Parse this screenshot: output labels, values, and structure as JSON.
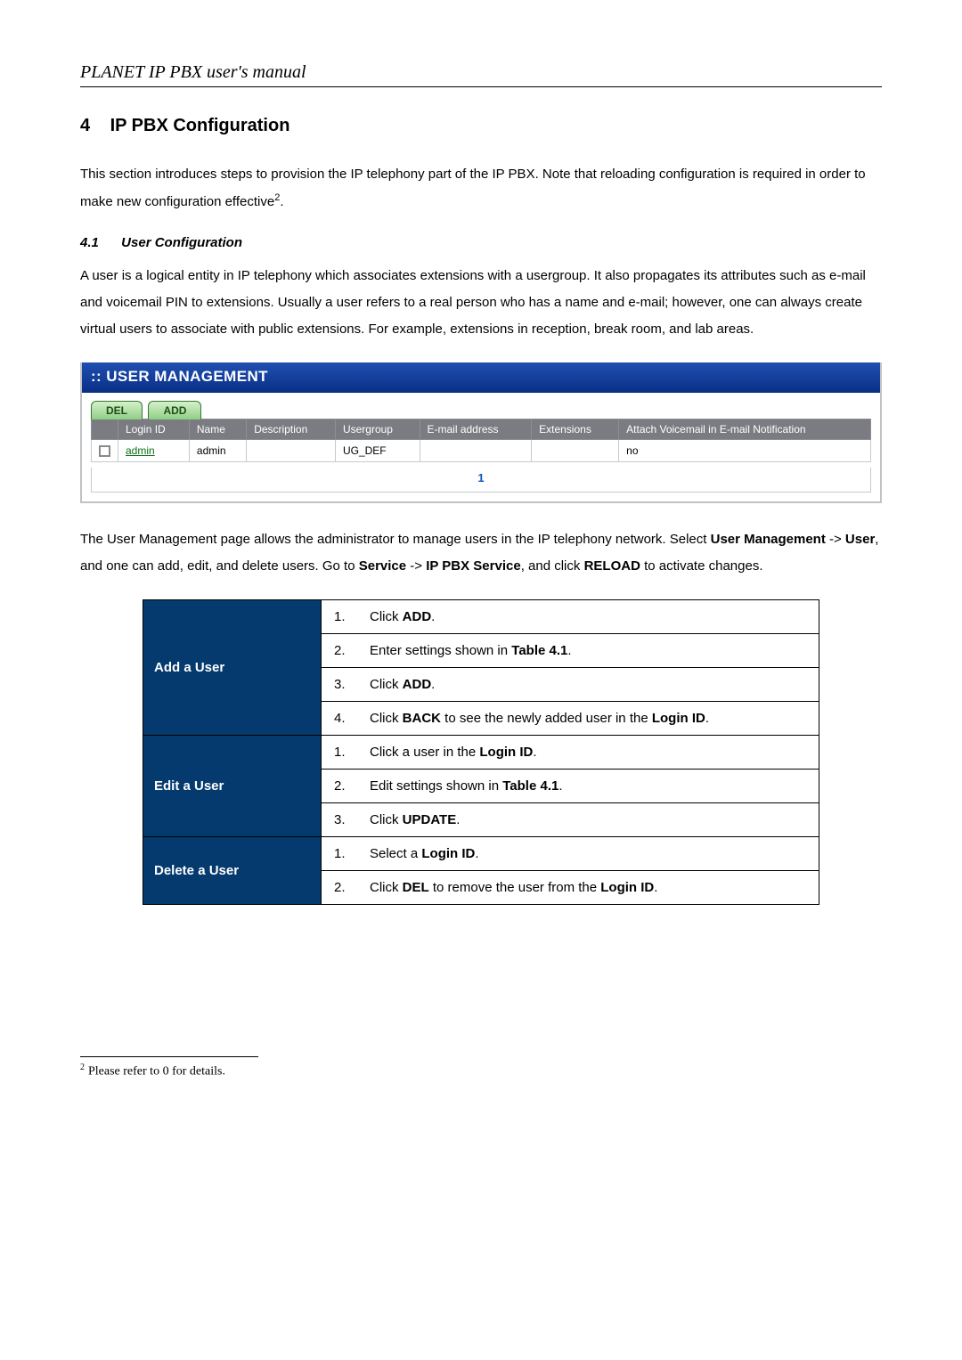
{
  "header": {
    "doc_title": "PLANET IP PBX user's manual"
  },
  "section": {
    "number": "4",
    "title": "IP PBX Configuration",
    "intro": "This section introduces steps to provision the IP telephony part of the IP PBX. Note that reloading configuration is required in order to make new configuration effective",
    "intro_sup": "2",
    "intro_end": "."
  },
  "subsection": {
    "number": "4.1",
    "title": "User Configuration",
    "para": "A user is a logical entity in IP telephony which associates extensions with a usergroup. It also propagates its attributes such as e-mail and voicemail PIN to extensions. Usually a user refers to a real person who has a name and e-mail; however, one can always create virtual users to associate with public extensions. For example, extensions in reception, break room, and lab areas."
  },
  "um": {
    "title": ":: USER MANAGEMENT",
    "tabs": {
      "del": "DEL",
      "add": "ADD"
    },
    "headers": {
      "checkbox": "",
      "login_id": "Login ID",
      "name": "Name",
      "description": "Description",
      "usergroup": "Usergroup",
      "email": "E-mail address",
      "extensions": "Extensions",
      "attach": "Attach Voicemail in E-mail Notification"
    },
    "rows": [
      {
        "login_id": "admin",
        "name": "admin",
        "description": "",
        "usergroup": "UG_DEF",
        "email": "",
        "extensions": "",
        "attach": "no"
      }
    ],
    "pager": "1"
  },
  "after_um_para_1a": "The User Management page allows the administrator to manage users in the IP telephony network. Select ",
  "after_um_b1": "User Management",
  "after_um_1b": " -> ",
  "after_um_b2": "User",
  "after_um_1c": ", and one can add, edit, and delete users. Go to ",
  "after_um_b3": "Service",
  "after_um_1d": " -> ",
  "after_um_b4": "IP PBX Service",
  "after_um_1e": ", and click ",
  "after_um_b5": "RELOAD",
  "after_um_1f": " to activate changes.",
  "proc": {
    "add": {
      "label": "Add a User",
      "steps": [
        {
          "n": "1.",
          "pre": "Click ",
          "b": "ADD",
          "post": "."
        },
        {
          "n": "2.",
          "pre": "Enter settings shown in ",
          "b": "Table 4.1",
          "post": "."
        },
        {
          "n": "3.",
          "pre": "Click ",
          "b": "ADD",
          "post": "."
        },
        {
          "n": "4.",
          "pre": "Click ",
          "b": "BACK",
          "mid": " to see the newly added user in the ",
          "b2": "Login ID",
          "post": "."
        }
      ]
    },
    "edit": {
      "label": "Edit a User",
      "steps": [
        {
          "n": "1.",
          "pre": "Click a user in the ",
          "b": "Login ID",
          "post": "."
        },
        {
          "n": "2.",
          "pre": "Edit settings shown in ",
          "b": "Table 4.1",
          "post": "."
        },
        {
          "n": "3.",
          "pre": "Click ",
          "b": "UPDATE",
          "post": "."
        }
      ]
    },
    "del": {
      "label": "Delete a User",
      "steps": [
        {
          "n": "1.",
          "pre": "Select a ",
          "b": "Login ID",
          "post": "."
        },
        {
          "n": "2.",
          "pre": "Click ",
          "b": "DEL",
          "mid": " to remove the user from the ",
          "b2": "Login ID",
          "post": "."
        }
      ]
    }
  },
  "footnote": {
    "mark": "2",
    "text": "Please refer to 0 for details."
  }
}
